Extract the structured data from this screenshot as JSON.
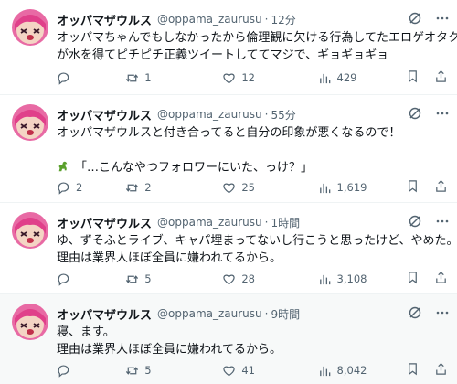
{
  "tweets": [
    {
      "name": "オッパマザウルス",
      "handle": "@oppama_zaurusu",
      "dot": "·",
      "time": "12分",
      "lines": [
        "オッパマちゃんでもしなかったから倫理観に欠ける行為してたエロゲオタク",
        "が水を得てピチピチ正義ツイートしててマジで、ギョギョギョ"
      ],
      "replies": "",
      "retweets": "1",
      "likes": "12",
      "views": "429"
    },
    {
      "name": "オッパマザウルス",
      "handle": "@oppama_zaurusu",
      "dot": "·",
      "time": "55分",
      "lines": [
        "オッパマザウルスと付き合ってると自分の印象が悪くなるので！",
        "",
        "「…こんなやつフォロワーにいた、っけ？」"
      ],
      "replies": "2",
      "retweets": "2",
      "likes": "25",
      "views": "1,619"
    },
    {
      "name": "オッパマザウルス",
      "handle": "@oppama_zaurusu",
      "dot": "·",
      "time": "1時間",
      "lines": [
        "ゆ、ずそふとライブ、キャパ埋まってないし行こうと思ったけど、やめた。",
        "理由は業界人ほぼ全員に嫌われてるから。"
      ],
      "replies": "",
      "retweets": "5",
      "likes": "28",
      "views": "3,108"
    },
    {
      "name": "オッパマザウルス",
      "handle": "@oppama_zaurusu",
      "dot": "·",
      "time": "9時間",
      "lines": [
        "寝、ます。",
        "理由は業界人ほぼ全員に嫌われてるから。"
      ],
      "replies": "",
      "retweets": "5",
      "likes": "41",
      "views": "8,042"
    }
  ],
  "icons": {
    "avatar": "avatar-image",
    "grok": "grok-icon",
    "more": "more-icon",
    "reply": "reply-icon",
    "retweet": "retweet-icon",
    "like": "like-icon",
    "views": "views-icon",
    "bookmark": "bookmark-icon",
    "share": "share-icon",
    "dinosaur": "dinosaur-emoji"
  },
  "colors": {
    "text": "#0f1419",
    "secondary": "#536471",
    "divider": "#eff3f4",
    "highlight_bg": "#f7f9f9"
  }
}
